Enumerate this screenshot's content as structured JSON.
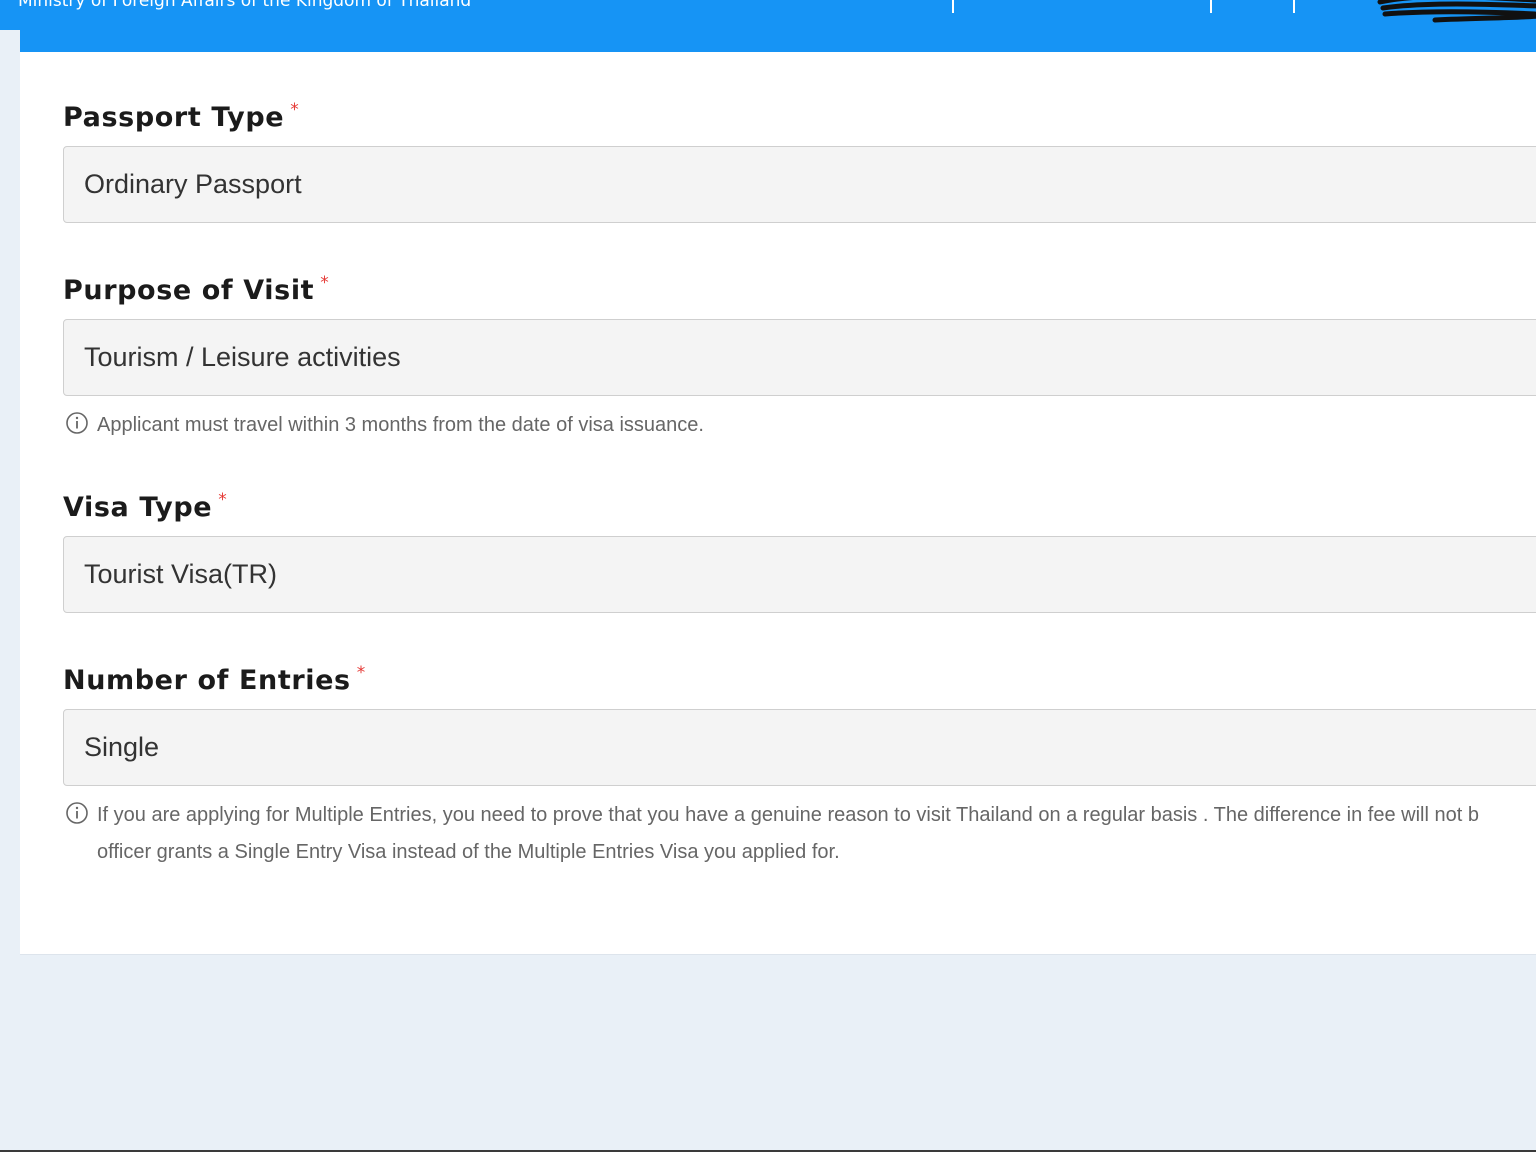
{
  "header": {
    "ministry_title": "Ministry of Foreign Affairs of the Kingdom of Thailand"
  },
  "form": {
    "required_marker": "*",
    "passport_type": {
      "label": "Passport Type",
      "value": "Ordinary Passport"
    },
    "purpose_of_visit": {
      "label": "Purpose of Visit",
      "value": "Tourism / Leisure activities",
      "hint": "Applicant must travel within 3 months from the date of visa issuance."
    },
    "visa_type": {
      "label": "Visa Type",
      "value": "Tourist Visa(TR)"
    },
    "number_of_entries": {
      "label": "Number of Entries",
      "value": "Single",
      "hint_line1": "If you are applying for Multiple Entries, you need to prove that you have a genuine reason to visit Thailand on a regular basis . The difference in fee will not b",
      "hint_line2": "officer grants a Single Entry Visa instead of the Multiple Entries Visa you applied for."
    }
  },
  "icons": {
    "hint_icon": "info-circle-icon"
  },
  "colors": {
    "header_bg": "#1694f5",
    "page_bg": "#e9f0f7",
    "required": "#e53935",
    "field_bg": "#f4f4f4"
  }
}
